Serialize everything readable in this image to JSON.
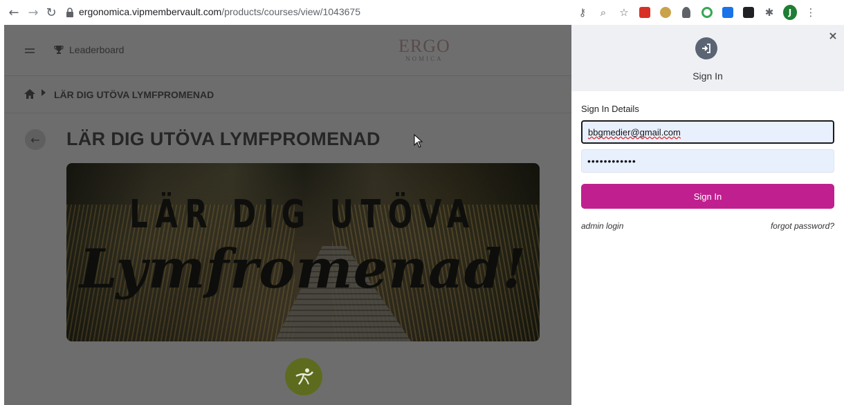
{
  "browser": {
    "url_domain": "ergonomica.vipmembervault.com",
    "url_path": "/products/courses/view/1043675",
    "profile_initial": "J"
  },
  "page": {
    "nav": {
      "leaderboard_label": "Leaderboard"
    },
    "logo": {
      "line1": "ERGO",
      "line2": "NOMICA"
    },
    "breadcrumb": {
      "current": "LÄR DIG UTÖVA LYMFPROMENAD"
    },
    "title": "LÄR DIG UTÖVA LYMFPROMENAD",
    "banner": {
      "line1": "LÄR DIG UTÖVA",
      "line2": "Lymfromenad!"
    }
  },
  "signin_panel": {
    "title": "Sign In",
    "details_label": "Sign In Details",
    "email_value": "bbgmedier@gmail.com",
    "password_value": "••••••••••••",
    "submit_label": "Sign In",
    "admin_link": "admin login",
    "forgot_link": "forgot password?",
    "close_symbol": "×"
  },
  "colors": {
    "accent": "#c0208f",
    "overlay": "#6d6d6d",
    "panel_header": "#eef0f4",
    "logo_green": "#5d6b1f"
  },
  "icons": [
    "back-arrow-icon",
    "forward-arrow-icon",
    "reload-icon",
    "lock-icon",
    "key-icon",
    "zoom-icon",
    "star-icon",
    "extension-icon",
    "puzzle-icon",
    "menu-icon",
    "trophy-icon",
    "home-icon",
    "sign-in-icon",
    "close-icon"
  ]
}
